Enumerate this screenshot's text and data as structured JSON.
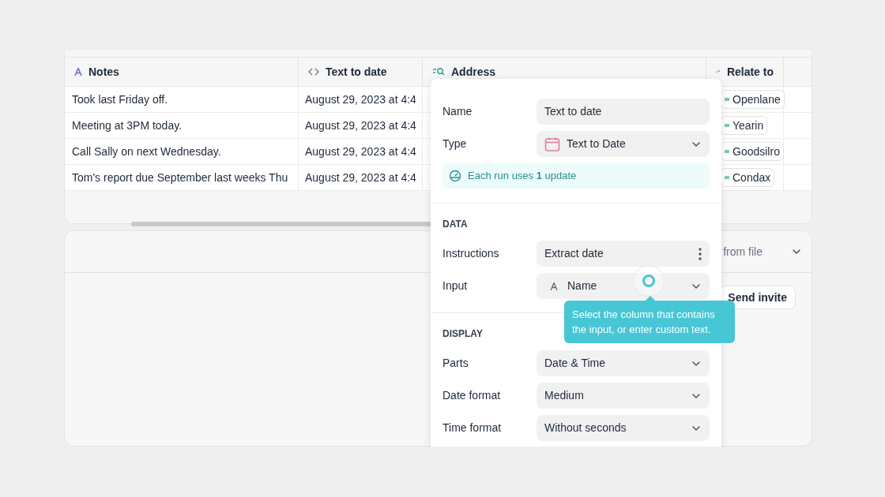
{
  "table": {
    "columns": [
      {
        "label": "Notes",
        "kind": "text"
      },
      {
        "label": "Text to date",
        "kind": "code"
      },
      {
        "label": "Address",
        "kind": "search"
      },
      {
        "label": "Relate to",
        "kind": "relate"
      }
    ],
    "rows": [
      {
        "notes": "Took last Friday off.",
        "text_to_date": "August 29, 2023 at 4:4",
        "relate_to": "Openlane"
      },
      {
        "notes": "Meeting at 3PM today.",
        "text_to_date": "August 29, 2023 at 4:4",
        "relate_to": "Yearin"
      },
      {
        "notes": "Call Sally on next Wednesday.",
        "text_to_date": "August 29, 2023 at 4:4",
        "relate_to": "Goodsilro"
      },
      {
        "notes": "Tom's report due September last weeks Thu",
        "text_to_date": "August 29, 2023 at 4:4",
        "relate_to": "Condax"
      }
    ]
  },
  "panel": {
    "select_value": "from file",
    "button": "Send invite"
  },
  "popover": {
    "fields": [
      {
        "kind": "text",
        "label": "Name",
        "value": "Text to date"
      },
      {
        "kind": "type",
        "label": "Type",
        "value": "Text to Date"
      }
    ],
    "notice": "Each run uses **1** update",
    "sections": [
      {
        "title": "DATA",
        "fields": [
          {
            "kind": "instructions",
            "label": "Instructions",
            "value": "Extract date"
          },
          {
            "kind": "column",
            "label": "Input",
            "value": "Name"
          }
        ]
      },
      {
        "title": "DISPLAY",
        "fields": [
          {
            "kind": "select",
            "label": "Parts",
            "value": "Date & Time"
          },
          {
            "kind": "select",
            "label": "Date format",
            "value": "Medium"
          },
          {
            "kind": "select",
            "label": "Time format",
            "value": "Without seconds"
          }
        ]
      }
    ]
  },
  "tooltip": "Select the column that contains the input, or enter custom text."
}
